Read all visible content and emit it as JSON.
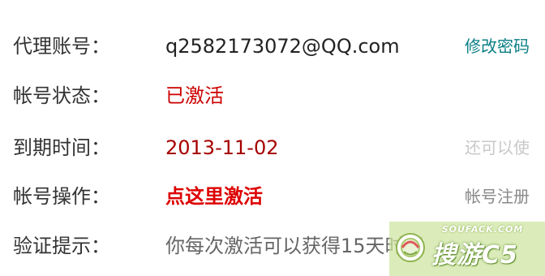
{
  "account_info": {
    "rows": [
      {
        "label": "代理账号：",
        "value": "q2582173072@QQ.com",
        "side": "修改密码"
      },
      {
        "label": "帐号状态：",
        "value": "已激活"
      },
      {
        "label": "到期时间：",
        "value": "2013-11-02",
        "side": "还可以使"
      },
      {
        "label": "帐号操作：",
        "value": "点这里激活",
        "side": "帐号注册"
      },
      {
        "label": "验证提示：",
        "value": "你每次激活可以获得15天时间"
      }
    ]
  },
  "watermark": {
    "top_text": "SOUFACK.COM",
    "brand_text": "搜游C5"
  },
  "colors": {
    "label_text": "#333333",
    "status_red": "#cc0000",
    "date_darkred": "#a50000",
    "link_teal": "#0b7f86",
    "watermark_bg": "#cde4a0"
  }
}
